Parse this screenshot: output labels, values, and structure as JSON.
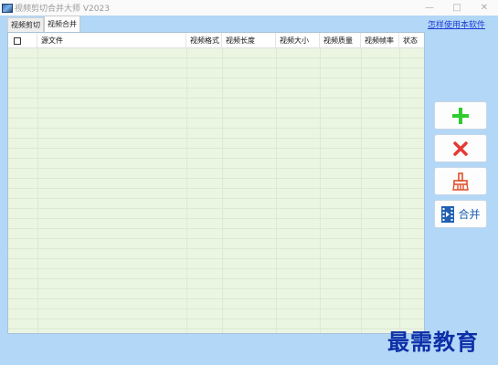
{
  "window": {
    "title": "视频剪切合并大师 V2023",
    "controls": [
      "—",
      "□",
      "✕"
    ]
  },
  "tabs": [
    {
      "label": "视频剪切"
    },
    {
      "label": "视频合并"
    }
  ],
  "help_link": "怎样使用本软件",
  "table": {
    "columns": [
      "源文件",
      "视频格式",
      "视频长度",
      "视频大小",
      "视频质量",
      "视频帧率",
      "状态"
    ],
    "rows": []
  },
  "merge_button_label": "合并",
  "icons": {
    "add": "plus-icon",
    "remove": "x-icon",
    "clear": "broom-icon",
    "merge": "film-icon"
  },
  "colors": {
    "add": "#2ecc2e",
    "remove": "#e53935",
    "clear": "#e0502a",
    "merge": "#1f5fb0"
  },
  "watermark": "最需教育"
}
